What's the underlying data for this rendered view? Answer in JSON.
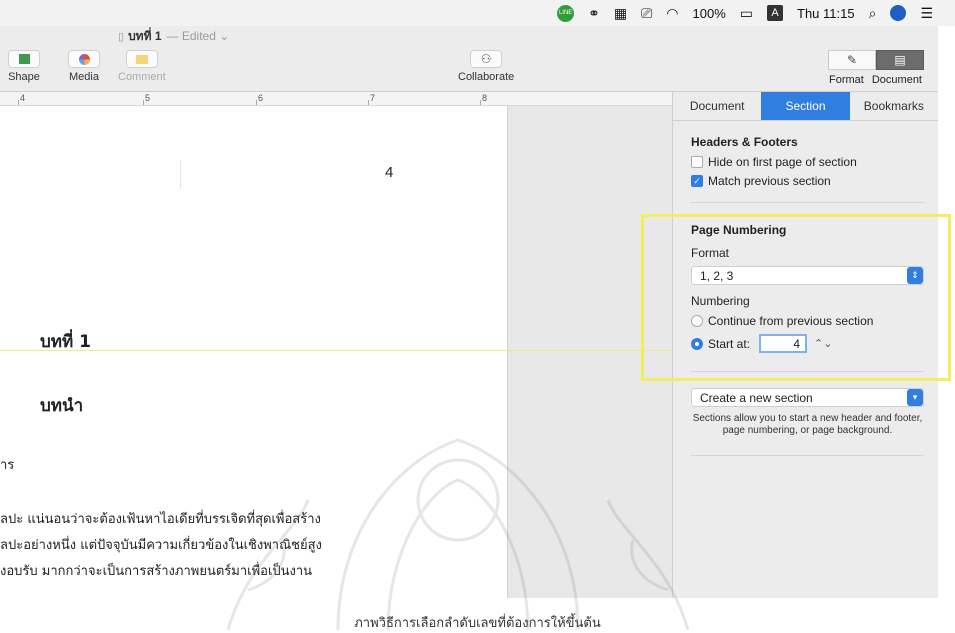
{
  "menubar": {
    "battery": "100%",
    "input_badge": "A",
    "clock": "Thu 11:15"
  },
  "window": {
    "doc_title": "บทที่ 1",
    "doc_state": "— Edited ⌄"
  },
  "toolbar": {
    "shape_label": "Shape",
    "media_label": "Media",
    "comment_label": "Comment",
    "collaborate_label": "Collaborate",
    "format_label": "Format",
    "document_label": "Document"
  },
  "ruler": {
    "ticks": [
      "4",
      "5",
      "6",
      "7",
      "8"
    ]
  },
  "document": {
    "page_number": "4",
    "chapter": "บทที่ 1",
    "chapter_title": "บทนำ",
    "section_head": "าร",
    "body_lines": [
      "ลปะ  แน่นอนว่าจะต้องเฟ้นหาไอเดียที่บรรเจิดที่สุดเพื่อสร้าง",
      "ลปะอย่างหนึ่ง  แต่ปัจจุบันมีความเกี่ยวข้องในเชิงพาณิชย์สูง",
      "งอบรับ   มากกว่าจะเป็นการสร้างภาพยนตร์มาเพื่อเป็นงาน"
    ]
  },
  "inspector": {
    "tabs": [
      {
        "label": "Document",
        "active": false
      },
      {
        "label": "Section",
        "active": true
      },
      {
        "label": "Bookmarks",
        "active": false
      }
    ],
    "headers_footers": {
      "title": "Headers & Footers",
      "hide_first": {
        "label": "Hide on first page of section",
        "checked": false
      },
      "match_previous": {
        "label": "Match previous section",
        "checked": true
      }
    },
    "page_numbering": {
      "title": "Page Numbering",
      "format_label": "Format",
      "format_value": "1, 2, 3",
      "numbering_label": "Numbering",
      "continue_label": "Continue from previous section",
      "start_label": "Start at:",
      "start_value": "4",
      "selected": "start"
    },
    "new_section": {
      "button": "Create a new section",
      "note": "Sections allow you to start a new header and footer, page numbering, or page background."
    }
  },
  "caption": "ภาพวิธีการเลือกลำดับเลขที่ต้องการให้ขึ้นต้น",
  "colors": {
    "accent": "#2f7ee0",
    "highlight": "#f3ee5e"
  }
}
